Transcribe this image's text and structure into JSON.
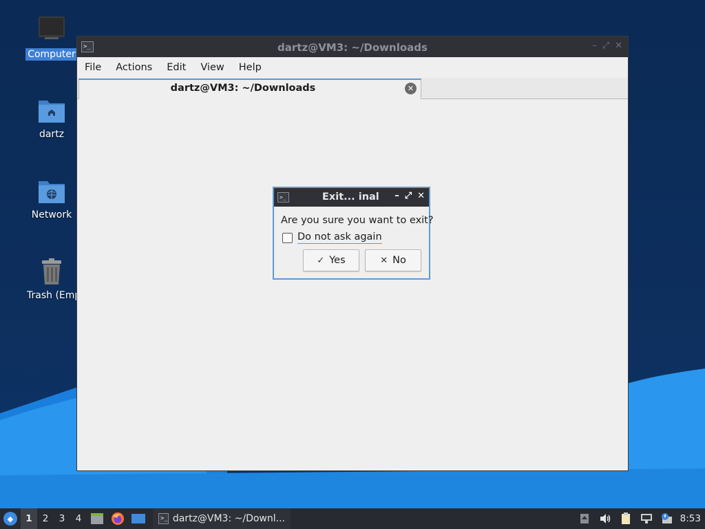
{
  "desktop": {
    "icons": [
      {
        "label": "Computer",
        "icon": "monitor-icon",
        "selected": true
      },
      {
        "label": "dartz",
        "icon": "home-folder-icon",
        "selected": false
      },
      {
        "label": "Network",
        "icon": "network-folder-icon",
        "selected": false
      },
      {
        "label": "Trash (Empt",
        "icon": "trash-icon",
        "selected": false
      }
    ]
  },
  "terminal": {
    "title": "dartz@VM3: ~/Downloads",
    "app_icon_glyph": ">_",
    "menu": [
      "File",
      "Actions",
      "Edit",
      "View",
      "Help"
    ],
    "tab": {
      "label": "dartz@VM3: ~/Downloads",
      "close_glyph": "✕"
    }
  },
  "dialog": {
    "title": "Exit...  inal",
    "app_icon_glyph": ">_",
    "controls": {
      "minimize": "–",
      "maximize": "⤢",
      "close": "✕"
    },
    "question": "Are you sure you want to exit?",
    "checkbox_label": "Do not ask again",
    "checkbox_checked": false,
    "yes_label": "Yes",
    "yes_glyph": "✓",
    "no_label": "No",
    "no_glyph": "✕"
  },
  "taskbar": {
    "workspaces": [
      "1",
      "2",
      "3",
      "4"
    ],
    "active_workspace": "1",
    "task_label": "dartz@VM3: ~/Downl...",
    "clock": "8:53"
  },
  "colors": {
    "accent": "#5b9bd5",
    "titlebar": "#2f3137",
    "taskbar": "#272a30",
    "desktop_bg": "#0b2a55",
    "wave": "#1e8fe8"
  }
}
